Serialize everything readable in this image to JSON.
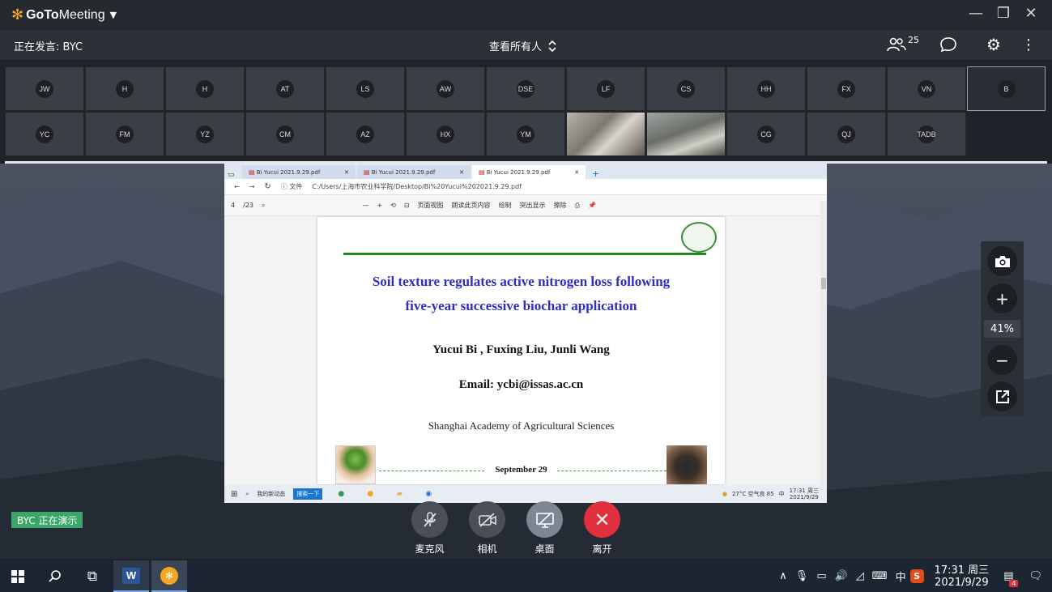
{
  "app": {
    "brand_goto": "GoTo",
    "brand_meeting": "Meeting",
    "window_controls": [
      "—",
      "❐",
      "✕"
    ]
  },
  "infobar": {
    "speaking": "正在发言: BYC",
    "view_all": "查看所有人",
    "participant_count": "25"
  },
  "participants": {
    "row1": [
      "JW",
      "H",
      "H",
      "AT",
      "LS",
      "AW",
      "DSE",
      "LF",
      "CS",
      "HH",
      "FX",
      "VN",
      "B"
    ],
    "row2": [
      "YC",
      "FM",
      "YZ",
      "CM",
      "AZ",
      "HX",
      "YM",
      "",
      "",
      "CG",
      "QJ",
      "TADB"
    ]
  },
  "browser": {
    "tabs": [
      {
        "label": "Bi Yucui 2021.9.29.pdf"
      },
      {
        "label": "Bi Yucui 2021.9.29.pdf"
      },
      {
        "label": "Bi Yucui 2021.9.29.pdf"
      }
    ],
    "addr_prefix": "文件",
    "url": "C:/Users/上海市农业科学院/Desktop/Bi%20Yucui%202021.9.29.pdf",
    "page_current": "4",
    "page_total": "/23",
    "tool_page_view": "页面视图",
    "tool_read_aloud": "朗读此页内容",
    "tool_draw": "绘制",
    "tool_highlight": "突出显示",
    "tool_erase": "擦除"
  },
  "pdf": {
    "title_line1": "Soil texture regulates active nitrogen loss following",
    "title_line2": "five-year successive biochar application",
    "authors": "Yucui Bi , Fuxing Liu, Junli Wang",
    "email": "Email: ycbi@issas.ac.cn",
    "affiliation": "Shanghai Academy of Agricultural Sciences",
    "date": "September 29"
  },
  "inner_taskbar": {
    "search_label": "我的新动态",
    "app_label": "搜索一下",
    "weather": "27°C 空气良 85",
    "ime": "中",
    "time": "17:31 周三",
    "date": "2021/9/29"
  },
  "zoom": {
    "level": "41%"
  },
  "presenting_badge": "BYC 正在演示",
  "controls": {
    "mic": "麦克风",
    "camera": "相机",
    "desktop": "桌面",
    "leave": "离开"
  },
  "taskbar": {
    "word_letter": "W",
    "ime": "中",
    "time": "17:31 周三",
    "date": "2021/9/29",
    "notif_count": "4"
  }
}
